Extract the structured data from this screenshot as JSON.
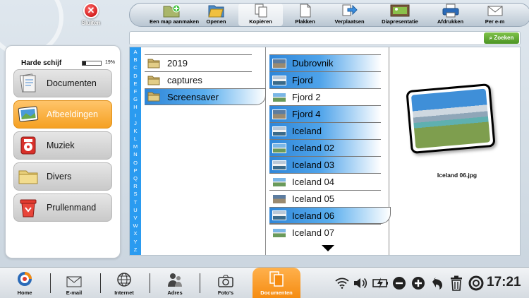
{
  "close": {
    "label": "Sluiten"
  },
  "toolbar": {
    "items": [
      {
        "label": "Een map aanmaken",
        "icon": "new-folder-icon"
      },
      {
        "label": "Openen",
        "icon": "open-icon"
      },
      {
        "label": "Kopiëren",
        "icon": "copy-icon",
        "selected": true
      },
      {
        "label": "Plakken",
        "icon": "paste-icon"
      },
      {
        "label": "Verplaatsen",
        "icon": "move-icon"
      },
      {
        "label": "Diapresentatie",
        "icon": "slideshow-icon"
      },
      {
        "label": "Afdrukken",
        "icon": "print-icon"
      },
      {
        "label": "Per e-m",
        "icon": "email-icon"
      }
    ]
  },
  "search": {
    "value": "",
    "button_label": "Zoeken"
  },
  "disk": {
    "title": "Harde schijf",
    "percent_label": "19%",
    "used_fraction": 0.19
  },
  "categories": [
    {
      "label": "Documenten",
      "icon": "documents-icon"
    },
    {
      "label": "Afbeeldingen",
      "icon": "pictures-icon",
      "active": true
    },
    {
      "label": "Muziek",
      "icon": "music-icon"
    },
    {
      "label": "Divers",
      "icon": "folder-icon"
    },
    {
      "label": "Prullenmand",
      "icon": "trash-icon"
    }
  ],
  "alphabet": [
    "A",
    "B",
    "C",
    "D",
    "E",
    "F",
    "G",
    "H",
    "I",
    "J",
    "K",
    "L",
    "M",
    "N",
    "O",
    "P",
    "Q",
    "R",
    "S",
    "T",
    "U",
    "V",
    "W",
    "X",
    "Y",
    "Z"
  ],
  "folders": [
    {
      "name": "2019"
    },
    {
      "name": "captures"
    },
    {
      "name": "Screensaver",
      "selected": true
    }
  ],
  "files": [
    {
      "name": "Dubrovnik",
      "highlighted": true
    },
    {
      "name": "Fjord",
      "highlighted": true
    },
    {
      "name": "Fjord 2",
      "highlighted": false
    },
    {
      "name": "Fjord 4",
      "highlighted": true
    },
    {
      "name": "Iceland",
      "highlighted": true
    },
    {
      "name": "Iceland 02",
      "highlighted": true
    },
    {
      "name": "Iceland 03",
      "highlighted": true
    },
    {
      "name": "Iceland 04",
      "highlighted": false
    },
    {
      "name": "Iceland 05",
      "highlighted": false
    },
    {
      "name": "Iceland 06",
      "highlighted": true,
      "current": true
    },
    {
      "name": "Iceland 07",
      "highlighted": false
    }
  ],
  "preview": {
    "filename": "Iceland 06.jpg"
  },
  "taskbar": {
    "apps": [
      {
        "label": "Home",
        "icon": "home-icon"
      },
      {
        "label": "E-mail",
        "icon": "envelope-icon"
      },
      {
        "label": "Internet",
        "icon": "globe-icon"
      },
      {
        "label": "Adres",
        "icon": "contacts-icon"
      },
      {
        "label": "Foto's",
        "icon": "camera-icon"
      },
      {
        "label": "Documenten",
        "icon": "documents-icon",
        "active": true
      }
    ],
    "clock": "17:21"
  }
}
